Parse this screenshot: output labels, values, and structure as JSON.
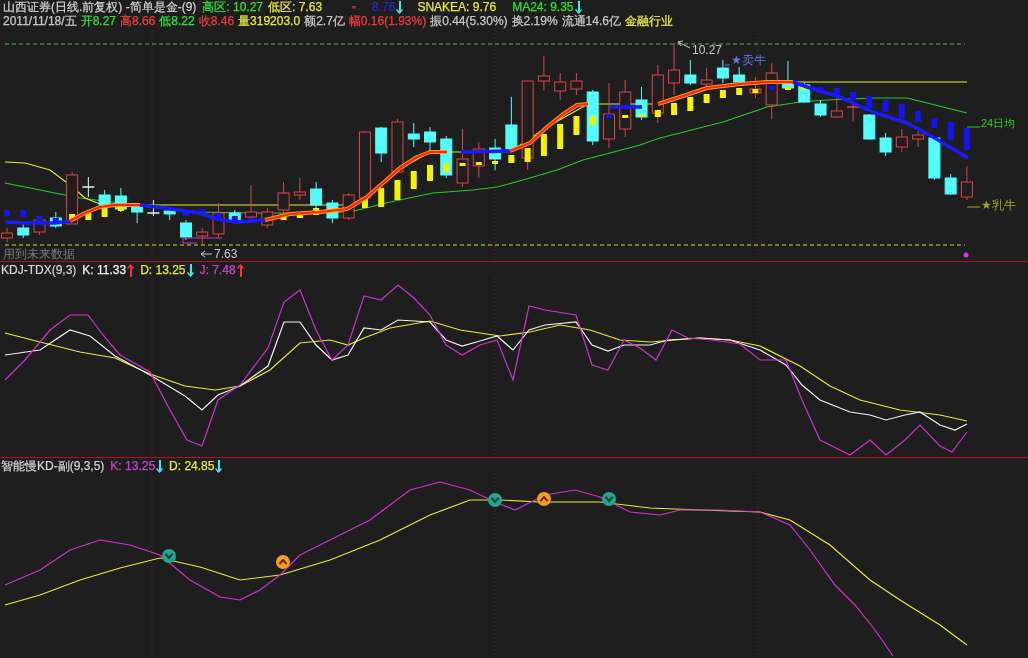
{
  "quote_header": {
    "title": "山西证券(日线.前复权) -简单是金-(9)",
    "readings": [
      {
        "kind": "value",
        "text": "高区: 10.27",
        "color": "#33e033"
      },
      {
        "kind": "value",
        "text": "低区: 7.63",
        "color": "#e8e838"
      },
      {
        "kind": "value",
        "text": "-",
        "color": "#b82828"
      },
      {
        "kind": "value",
        "text": "8.76",
        "color": "#2828c8"
      },
      {
        "kind": "down_arrow",
        "color": "#40e8f0"
      },
      {
        "kind": "value",
        "text": "SNAKEA: 9.76",
        "color": "#e8e838"
      },
      {
        "kind": "value",
        "text": "MA24: 9.35",
        "color": "#33e033"
      },
      {
        "kind": "down_arrow",
        "color": "#40e8f0"
      }
    ]
  },
  "quote_line": [
    {
      "text": "2011/11/18/五",
      "color": "#c8c8c8"
    },
    {
      "text": "开8.27",
      "color": "#33e033"
    },
    {
      "text": "高8.66",
      "color": "#f03c3c"
    },
    {
      "text": "低8.22",
      "color": "#33e033"
    },
    {
      "text": "收8.46",
      "color": "#f03c3c"
    },
    {
      "text": "量319203.0",
      "color": "#e8e838"
    },
    {
      "text": "额2.7亿",
      "color": "#c8c8c8"
    },
    {
      "text": "幅0.16(1.93%)",
      "color": "#f03c3c"
    },
    {
      "text": "振0.44(5.30%)",
      "color": "#c8c8c8"
    },
    {
      "text": "换2.19%",
      "color": "#c8c8c8"
    },
    {
      "text": "流通14.6亿",
      "color": "#c8c8c8"
    },
    {
      "text": "金融行业",
      "color": "#e8e838"
    }
  ],
  "main_chart": {
    "high_label": "10.27",
    "low_label": "7.63",
    "signals": [
      {
        "text": "★卖牛",
        "color": "#5a7cf0"
      },
      {
        "text": "★乳牛",
        "color": "#a8a020"
      }
    ],
    "ma_label": "24日均",
    "note": "用到未来数据"
  },
  "kdj_panel": {
    "title": "KDJ-TDX(9,3)",
    "readings": [
      {
        "kind": "value",
        "text": "K: 11.33",
        "color": "#f0f0f0"
      },
      {
        "kind": "up_arrow",
        "color": "#ff3030"
      },
      {
        "kind": "value",
        "text": "D: 13.25",
        "color": "#e8e838"
      },
      {
        "kind": "down_arrow",
        "color": "#40e8f0"
      },
      {
        "kind": "value",
        "text": "J: 7.48",
        "color": "#d040d0"
      },
      {
        "kind": "up_arrow",
        "color": "#ff3030"
      }
    ]
  },
  "slow_kd_panel": {
    "title": "智能慢KD-副(9,3,5)",
    "readings": [
      {
        "kind": "value",
        "text": "K: 13.25",
        "color": "#d040d0"
      },
      {
        "kind": "down_arrow",
        "color": "#40e8f0"
      },
      {
        "kind": "value",
        "text": "D: 24.85",
        "color": "#e8e838"
      },
      {
        "kind": "down_arrow",
        "color": "#40e8f0"
      }
    ]
  }
}
